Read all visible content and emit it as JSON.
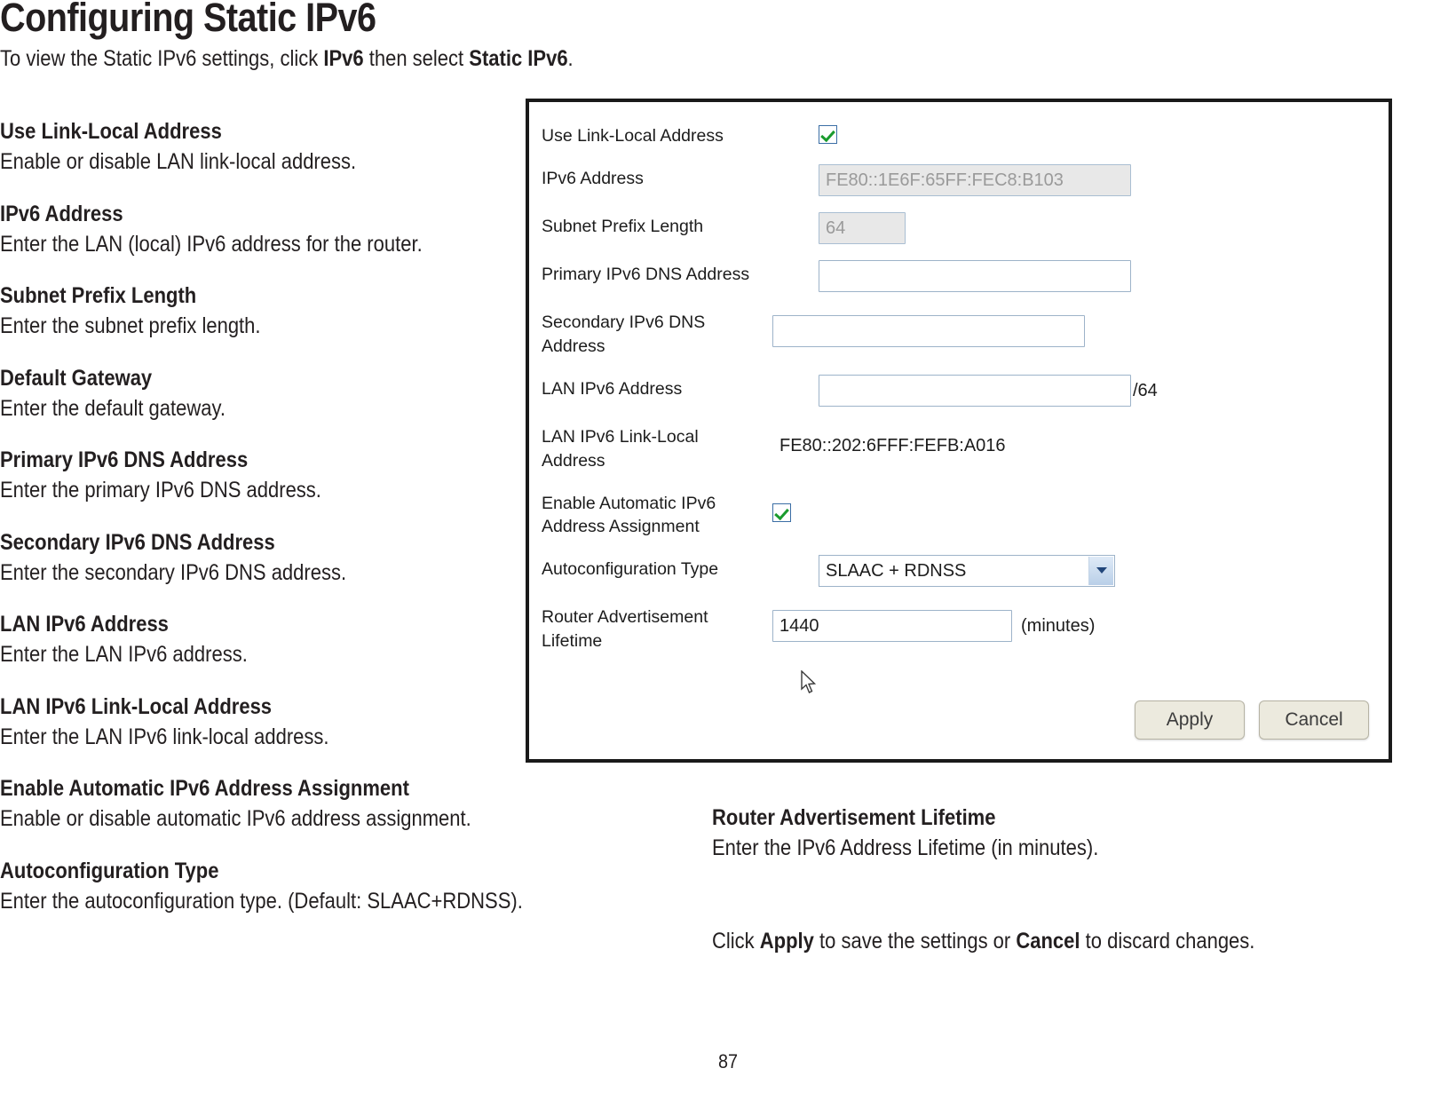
{
  "document": {
    "title": "Configuring Static IPv6",
    "intro_before": "To view the Static IPv6 settings, click ",
    "intro_bold1": "IPv6",
    "intro_middle": " then select ",
    "intro_bold2": "Static IPv6",
    "intro_after": ".",
    "page_number": "87"
  },
  "left_column": [
    {
      "term": "Use Link-Local Address",
      "desc": "Enable or disable LAN link-local address."
    },
    {
      "term": "IPv6 Address",
      "desc": "Enter the LAN (local) IPv6 address for the router."
    },
    {
      "term": "Subnet Prefix Length",
      "desc": "Enter the subnet prefix length."
    },
    {
      "term": "Default Gateway",
      "desc": "Enter the default gateway."
    },
    {
      "term": "Primary IPv6 DNS Address",
      "desc": "Enter the primary IPv6 DNS address."
    },
    {
      "term": "Secondary IPv6 DNS Address",
      "desc": "Enter the secondary IPv6 DNS address."
    },
    {
      "term": "LAN IPv6 Address",
      "desc": "Enter the LAN IPv6 address."
    },
    {
      "term": "LAN IPv6 Link-Local Address",
      "desc": "Enter the LAN IPv6 link-local address."
    },
    {
      "term": "Enable Automatic IPv6 Address Assignment",
      "desc": "Enable or disable automatic IPv6 address assignment."
    },
    {
      "term": "Autoconfiguration Type",
      "desc": "Enter the autoconfiguration type. (Default: SLAAC+RDNSS)."
    }
  ],
  "right_column": {
    "term": "Router Advertisement Lifetime",
    "desc": "Enter the IPv6 Address Lifetime (in minutes).",
    "closing_before": "Click ",
    "closing_bold1": "Apply",
    "closing_middle": " to save the settings or ",
    "closing_bold2": "Cancel",
    "closing_after": " to discard changes."
  },
  "screenshot": {
    "fields": {
      "use_link_local_label": "Use Link-Local Address",
      "use_link_local_checked": true,
      "ipv6_address_label": "IPv6 Address",
      "ipv6_address_value": "FE80::1E6F:65FF:FEC8:B103",
      "subnet_prefix_label": "Subnet Prefix Length",
      "subnet_prefix_value": "64",
      "primary_dns_label": "Primary IPv6 DNS Address",
      "primary_dns_value": "",
      "secondary_dns_label": "Secondary IPv6 DNS Address",
      "secondary_dns_value": "",
      "lan_ipv6_label": "LAN IPv6 Address",
      "lan_ipv6_value": "",
      "lan_ipv6_suffix": "/64",
      "lan_link_local_label": "LAN IPv6 Link-Local Address",
      "lan_link_local_value": "FE80::202:6FFF:FEFB:A016",
      "auto_assign_label": "Enable Automatic IPv6 Address Assignment",
      "auto_assign_checked": true,
      "autoconfig_label": "Autoconfiguration Type",
      "autoconfig_value": "SLAAC + RDNSS",
      "ra_lifetime_label": "Router Advertisement Lifetime",
      "ra_lifetime_value": "1440",
      "ra_lifetime_units": "(minutes)"
    },
    "buttons": {
      "apply": "Apply",
      "cancel": "Cancel"
    }
  }
}
